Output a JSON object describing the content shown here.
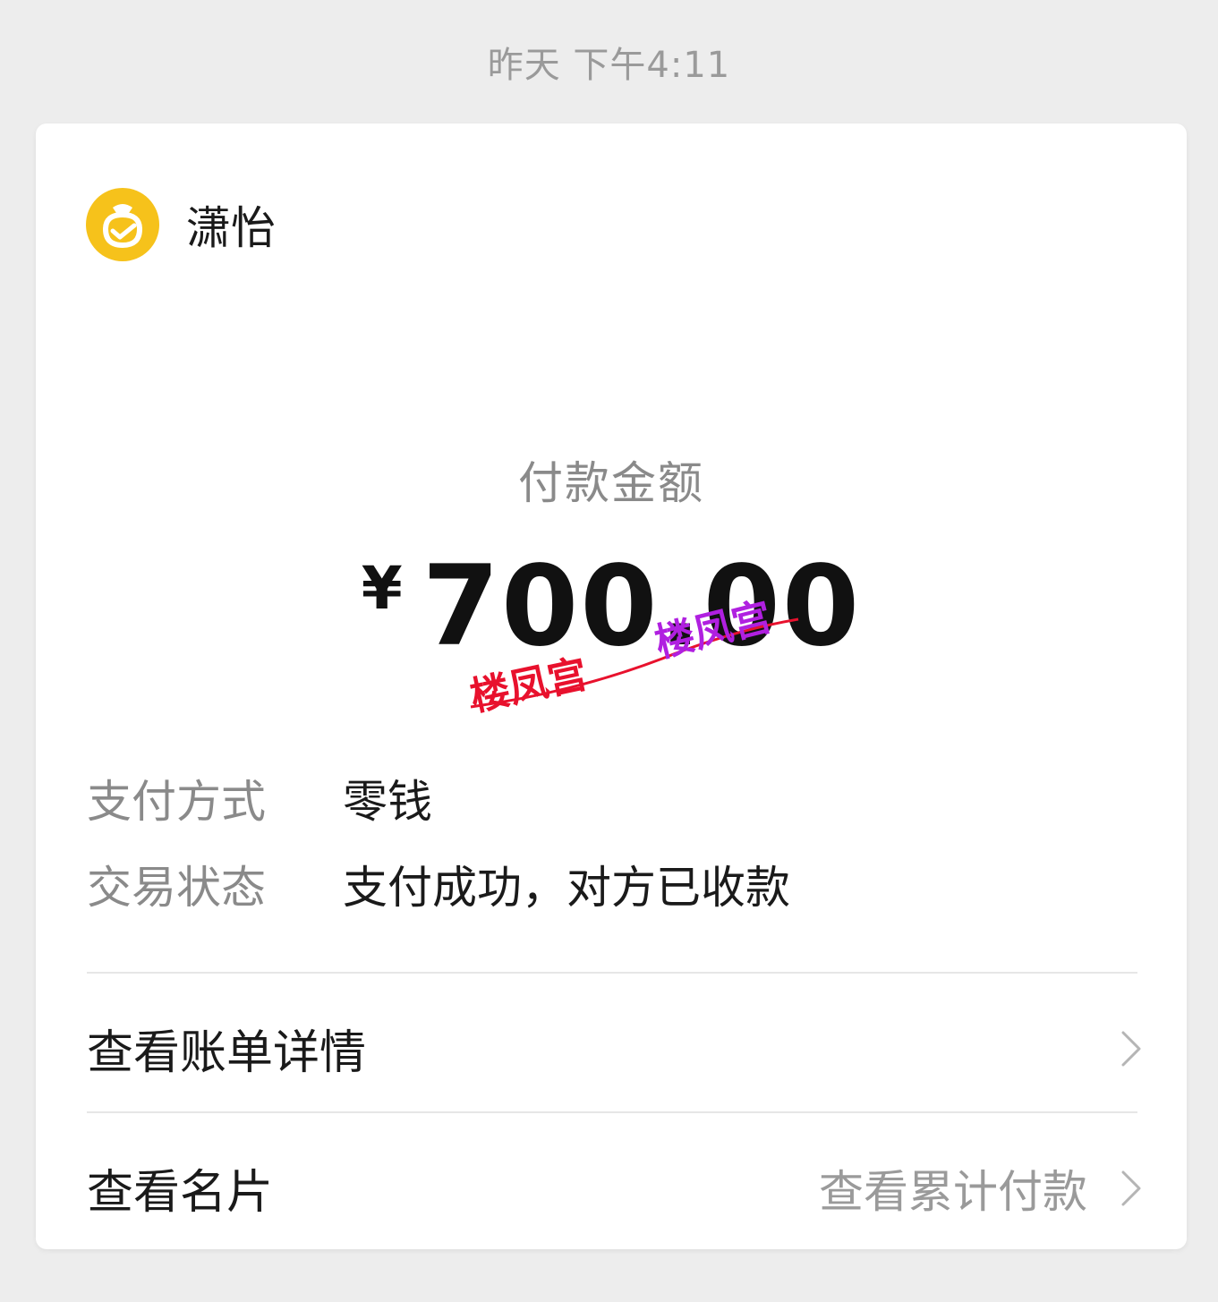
{
  "timestamp": "昨天 下午4:11",
  "merchant": {
    "name": "潇怡",
    "logo_icon": "wechat-pay-purse-icon",
    "logo_color": "#f6c21b"
  },
  "payment": {
    "amount_label": "付款金额",
    "currency": "¥",
    "amount": "700.00"
  },
  "details": {
    "method_label": "支付方式",
    "method_value": "零钱",
    "status_label": "交易状态",
    "status_value": "支付成功，对方已收款"
  },
  "links": {
    "bill_label": "查看账单详情",
    "card_label": "查看名片",
    "cumulative_label": "查看累计付款",
    "chevron_icon": "chevron-right-icon"
  },
  "watermarks": {
    "red_text": "楼凤宫",
    "purple_text": "楼凤宫",
    "red_color": "#e8112d",
    "purple_color": "#b020e0"
  }
}
